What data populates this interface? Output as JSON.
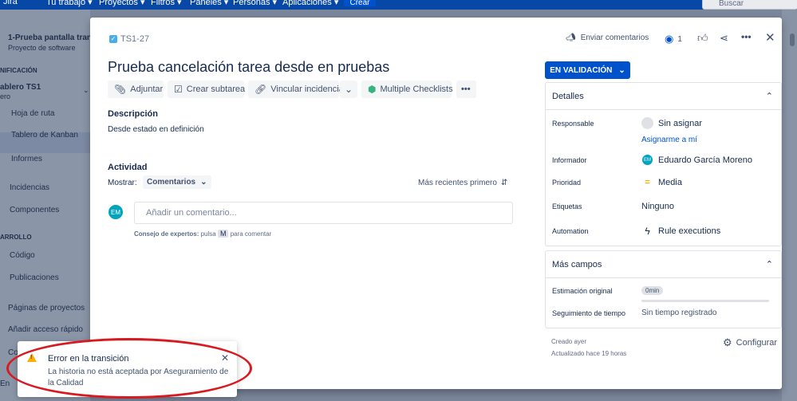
{
  "topnav": {
    "logo": "Jira",
    "items": [
      "Tu trabajo ▾",
      "Proyectos ▾",
      "Filtros ▾",
      "Paneles ▾",
      "Personas ▾",
      "Aplicaciones ▾"
    ],
    "create_label": "Crear",
    "search_placeholder": "Buscar"
  },
  "sidebar": {
    "project_name": "1-Prueba pantalla tran...",
    "project_type": "Proyecto de software",
    "section_planning": "NIFICACIÓN",
    "board_name": "ablero TS1",
    "board_sub": "ero",
    "items": {
      "roadmap": "Hoja de ruta",
      "kanban": "Tablero de Kanban",
      "reports": "Informes",
      "incidents": "Incidencias",
      "components": "Componentes",
      "code": "Código",
      "releases": "Publicaciones",
      "project_pages": "Páginas de proyectos",
      "quick_access": "Añadir acceso rápido"
    },
    "section_dev": "ARROLLO",
    "partial_c": "Co",
    "partial_en": "En"
  },
  "issue": {
    "key": "TS1-27",
    "title": "Prueba cancelación tarea desde en pruebas",
    "header": {
      "send_feedback": "Enviar comentarios",
      "watch_count": "1"
    },
    "toolbar": {
      "attach": "Adjuntar",
      "subtask": "Crear subtarea",
      "link": "Vincular incidencia",
      "checklists": "Multiple Checklists"
    },
    "description_label": "Descripción",
    "description_text": "Desde estado en definición",
    "activity_label": "Actividad",
    "show_label": "Mostrar:",
    "show_value": "Comentarios",
    "sort_label": "Más recientes primero",
    "comment_placeholder": "Añadir un comentario...",
    "avatar_initials": "EM",
    "tip_bold": "Consejo de expertos:",
    "tip_pre": "pulsa",
    "tip_key": "M",
    "tip_post": "para comentar",
    "status": "EN VALIDACIÓN",
    "details": {
      "title": "Detalles",
      "assignee_label": "Responsable",
      "assignee_value": "Sin asignar",
      "assign_me": "Asignarme a mí",
      "reporter_label": "Informador",
      "reporter_value": "Eduardo García Moreno",
      "priority_label": "Prioridad",
      "priority_value": "Media",
      "labels_label": "Etiquetas",
      "labels_value": "Ninguno",
      "automation_label": "Automation",
      "automation_value": "Rule executions"
    },
    "more_fields": {
      "title": "Más campos",
      "estimate_label": "Estimación original",
      "estimate_value": "0min",
      "tracking_label": "Seguimiento de tiempo",
      "tracking_value": "Sin tiempo registrado"
    },
    "created": "Creado ayer",
    "updated": "Actualizado hace 19 horas",
    "configure": "Configurar"
  },
  "toast": {
    "title": "Error en la transición",
    "body": "La historia no está aceptada por Aseguramiento de la Calidad"
  },
  "colors": {
    "primary": "#0052cc",
    "annotation": "#d71920",
    "warning": "#ffab00"
  }
}
